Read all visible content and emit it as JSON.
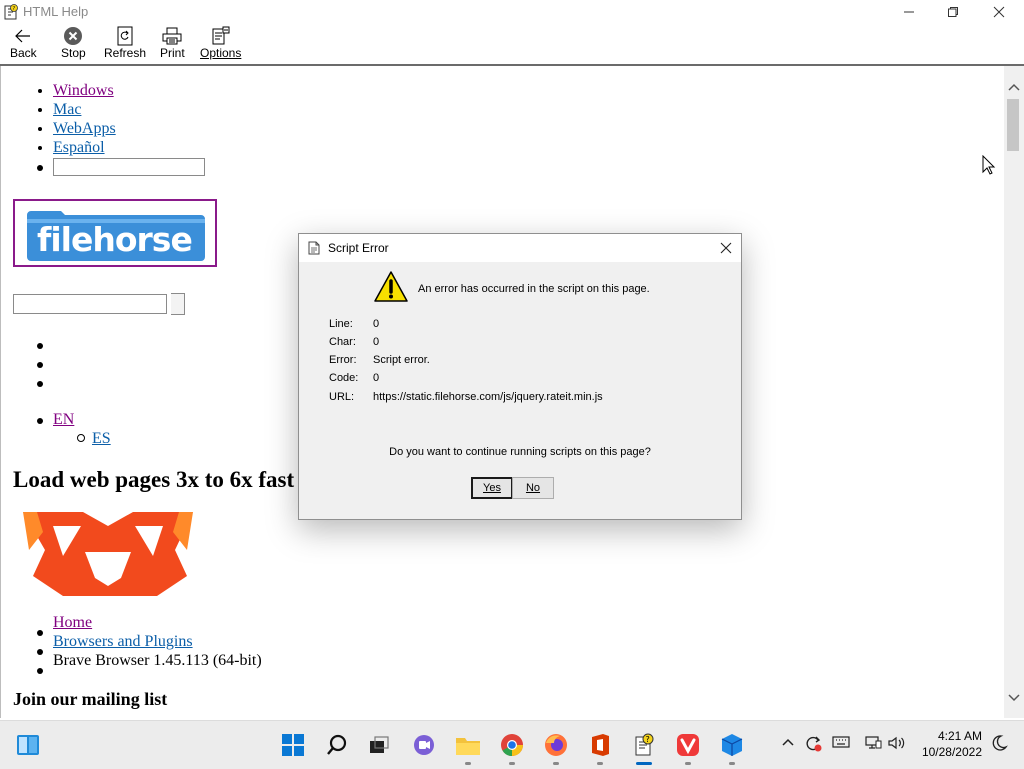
{
  "window": {
    "title": "HTML Help"
  },
  "toolbar": [
    {
      "label": "Back",
      "icon": "back-arrow-icon"
    },
    {
      "label": "Stop",
      "icon": "stop-icon"
    },
    {
      "label": "Refresh",
      "icon": "refresh-icon"
    },
    {
      "label": "Print",
      "icon": "printer-icon"
    },
    {
      "label": "Options",
      "icon": "options-icon"
    }
  ],
  "page": {
    "nav": [
      "Windows",
      "Mac",
      "WebApps",
      "Español"
    ],
    "lang": {
      "current": "EN",
      "other": "ES"
    },
    "heading": "Load web pages 3x to 6x fast",
    "breadcrumb": [
      "Home",
      "Browsers and Plugins",
      "Brave Browser 1.45.113 (64-bit)"
    ],
    "mailing": "Join our mailing list"
  },
  "dialog": {
    "title": "Script Error",
    "message": "An error has occurred in the script on this page.",
    "fields": [
      {
        "key": "Line:",
        "value": "0"
      },
      {
        "key": "Char:",
        "value": "0"
      },
      {
        "key": "Error:",
        "value": "Script error."
      },
      {
        "key": "Code:",
        "value": "0"
      },
      {
        "key": "URL:",
        "value": "https://static.filehorse.com/js/jquery.rateit.min.js"
      }
    ],
    "question": "Do you want to continue running scripts on this page?",
    "yes": "Yes",
    "no": "No"
  },
  "taskbar": {
    "time": "4:21 AM",
    "date": "10/28/2022"
  },
  "colors": {
    "visited_link": "#800080",
    "link": "#0b5ea8",
    "filehorse_blue": "#3b8fd9",
    "brave_orange": "#f24a1d",
    "accent": "#0067c0"
  }
}
